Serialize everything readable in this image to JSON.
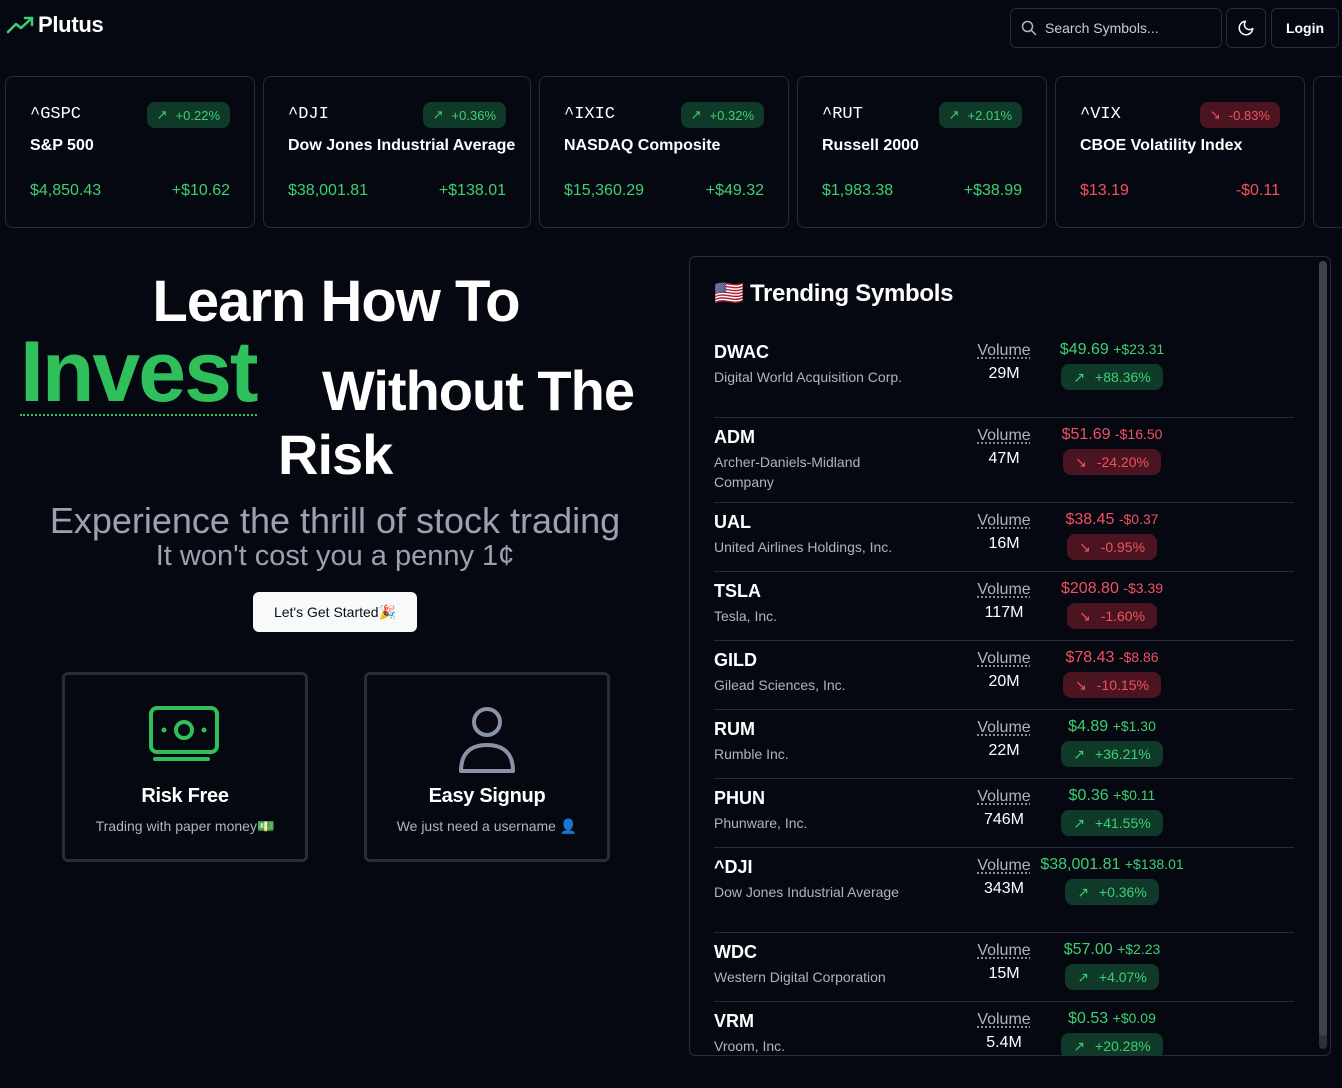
{
  "header": {
    "logo_text": "Plutus",
    "search_placeholder": "Search Symbols...",
    "login_label": "Login"
  },
  "tickers": [
    {
      "symbol": "^GSPC",
      "name": "S&P 500",
      "pct": "+0.22%",
      "price": "$4,850.43",
      "change": "+$10.62",
      "dir": "up"
    },
    {
      "symbol": "^DJI",
      "name": "Dow Jones Industrial Average",
      "pct": "+0.36%",
      "price": "$38,001.81",
      "change": "+$138.01",
      "dir": "up"
    },
    {
      "symbol": "^IXIC",
      "name": "NASDAQ Composite",
      "pct": "+0.32%",
      "price": "$15,360.29",
      "change": "+$49.32",
      "dir": "up"
    },
    {
      "symbol": "^RUT",
      "name": "Russell 2000",
      "pct": "+2.01%",
      "price": "$1,983.38",
      "change": "+$38.99",
      "dir": "up"
    },
    {
      "symbol": "^VIX",
      "name": "CBOE Volatility Index",
      "pct": "-0.83%",
      "price": "$13.19",
      "change": "-$0.11",
      "dir": "down"
    }
  ],
  "hero": {
    "line1": "Learn How To",
    "invest": "Invest",
    "without": "Without The",
    "risk": "Risk",
    "sub1": "Experience the thrill of stock trading",
    "sub2": "It won't cost you a penny 1¢",
    "cta": "Let's Get Started🎉"
  },
  "features": [
    {
      "title": "Risk Free",
      "desc": "Trading with paper money💵",
      "icon": "banknote-icon"
    },
    {
      "title": "Easy Signup",
      "desc": "We just need a username 👤",
      "icon": "user-icon"
    }
  ],
  "trending": {
    "title": "🇺🇸 Trending Symbols",
    "volume_label": "Volume",
    "rows": [
      {
        "symbol": "DWAC",
        "name": "Digital World Acquisition Corp.",
        "volume": "29M",
        "price": "$49.69",
        "delta": "+$23.31",
        "pct": "+88.36%",
        "dir": "up",
        "two_line": true
      },
      {
        "symbol": "ADM",
        "name": "Archer-Daniels-Midland Company",
        "volume": "47M",
        "price": "$51.69",
        "delta": "-$16.50",
        "pct": "-24.20%",
        "dir": "down",
        "two_line": true
      },
      {
        "symbol": "UAL",
        "name": "United Airlines Holdings, Inc.",
        "volume": "16M",
        "price": "$38.45",
        "delta": "-$0.37",
        "pct": "-0.95%",
        "dir": "down",
        "two_line": false
      },
      {
        "symbol": "TSLA",
        "name": "Tesla, Inc.",
        "volume": "117M",
        "price": "$208.80",
        "delta": "-$3.39",
        "pct": "-1.60%",
        "dir": "down",
        "two_line": false
      },
      {
        "symbol": "GILD",
        "name": "Gilead Sciences, Inc.",
        "volume": "20M",
        "price": "$78.43",
        "delta": "-$8.86",
        "pct": "-10.15%",
        "dir": "down",
        "two_line": false
      },
      {
        "symbol": "RUM",
        "name": "Rumble Inc.",
        "volume": "22M",
        "price": "$4.89",
        "delta": "+$1.30",
        "pct": "+36.21%",
        "dir": "up",
        "two_line": false
      },
      {
        "symbol": "PHUN",
        "name": "Phunware, Inc.",
        "volume": "746M",
        "price": "$0.36",
        "delta": "+$0.11",
        "pct": "+41.55%",
        "dir": "up",
        "two_line": false
      },
      {
        "symbol": "^DJI",
        "name": "Dow Jones Industrial Average",
        "volume": "343M",
        "price": "$38,001.81",
        "delta": "+$138.01",
        "pct": "+0.36%",
        "dir": "up",
        "two_line": true
      },
      {
        "symbol": "WDC",
        "name": "Western Digital Corporation",
        "volume": "15M",
        "price": "$57.00",
        "delta": "+$2.23",
        "pct": "+4.07%",
        "dir": "up",
        "two_line": false
      },
      {
        "symbol": "VRM",
        "name": "Vroom, Inc.",
        "volume": "5.4M",
        "price": "$0.53",
        "delta": "+$0.09",
        "pct": "+20.28%",
        "dir": "up",
        "two_line": false
      }
    ]
  },
  "colors": {
    "background": "#050811",
    "up": "#3ecf71",
    "down": "#f4505f",
    "accent_green": "#2fc05b",
    "border": "#272c36"
  }
}
